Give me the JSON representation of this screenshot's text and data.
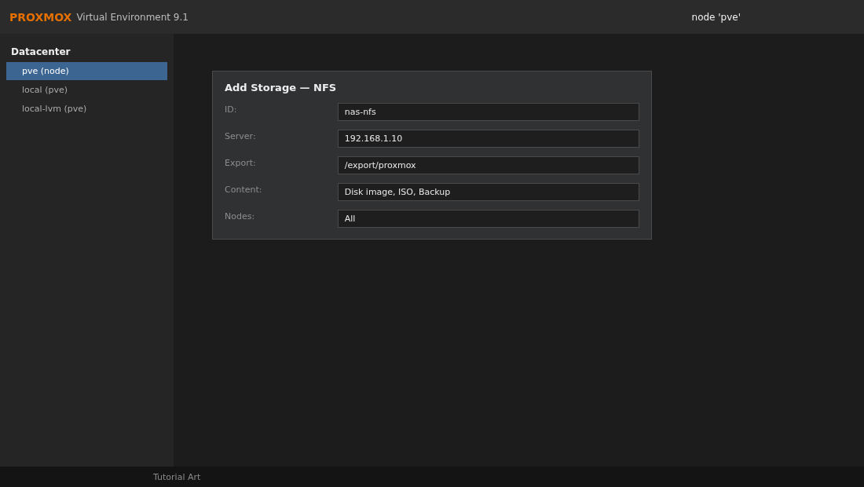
{
  "header": {
    "brand": "PROXMOX",
    "product": "Virtual Environment 9.1",
    "context": "node 'pve'"
  },
  "sidebar": {
    "title": "Datacenter",
    "items": [
      {
        "label": "pve (node)",
        "selected": true
      },
      {
        "label": "local (pve)",
        "selected": false
      },
      {
        "label": "local-lvm (pve)",
        "selected": false
      }
    ]
  },
  "dialog": {
    "title": "Add Storage — NFS",
    "fields": [
      {
        "label": "ID:",
        "value": "nas-nfs"
      },
      {
        "label": "Server:",
        "value": "192.168.1.10"
      },
      {
        "label": "Export:",
        "value": "/export/proxmox"
      },
      {
        "label": "Content:",
        "value": "Disk image, ISO, Backup"
      },
      {
        "label": "Nodes:",
        "value": "All"
      }
    ]
  },
  "footer": {
    "text": "Tutorial Art"
  }
}
